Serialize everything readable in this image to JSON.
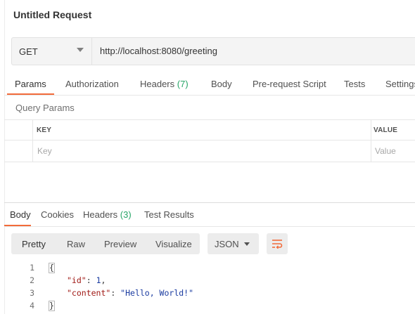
{
  "request": {
    "title": "Untitled Request",
    "method": "GET",
    "url": "http://localhost:8080/greeting"
  },
  "request_tabs": [
    {
      "label": "Params",
      "count": ""
    },
    {
      "label": "Authorization",
      "count": ""
    },
    {
      "label": "Headers",
      "count": "(7)"
    },
    {
      "label": "Body",
      "count": ""
    },
    {
      "label": "Pre-request Script",
      "count": ""
    },
    {
      "label": "Tests",
      "count": ""
    },
    {
      "label": "Settings",
      "count": ""
    }
  ],
  "query_params": {
    "label": "Query Params",
    "columns": {
      "key": "KEY",
      "value": "VALUE"
    },
    "placeholders": {
      "key": "Key",
      "value": "Value"
    }
  },
  "response_tabs": [
    {
      "label": "Body",
      "count": ""
    },
    {
      "label": "Cookies",
      "count": ""
    },
    {
      "label": "Headers",
      "count": "(3)"
    },
    {
      "label": "Test Results",
      "count": ""
    }
  ],
  "view_modes": [
    "Pretty",
    "Raw",
    "Preview",
    "Visualize"
  ],
  "format": "JSON",
  "response_body": {
    "line_numbers": [
      "1",
      "2",
      "3",
      "4"
    ],
    "open_brace": "{",
    "close_brace": "}",
    "fields": [
      {
        "key": "\"id\"",
        "value": "1",
        "sep": ": ",
        "trail": ","
      },
      {
        "key": "\"content\"",
        "value": "\"Hello, World!\"",
        "sep": ": ",
        "trail": ""
      }
    ]
  },
  "colors": {
    "accent": "#f26b3a",
    "count": "#26a567",
    "json_key": "#a01a16",
    "json_value": "#1a3ba0"
  },
  "icons": {
    "method_dropdown": "caret-down-icon",
    "format_dropdown": "caret-down-icon",
    "wrap": "wrap-lines-icon"
  }
}
